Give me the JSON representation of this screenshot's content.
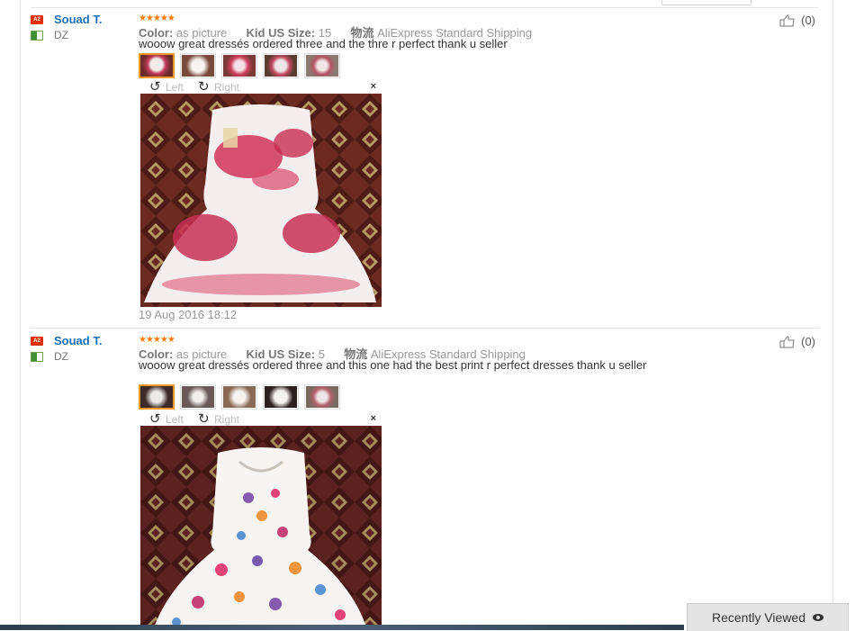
{
  "reviews": [
    {
      "badge": "A2",
      "user": "Souad T.",
      "country": "DZ",
      "stars": "★★★★★",
      "color_label": "Color:",
      "color_value": "as picture",
      "size_label": "Kid US Size:",
      "size_value": "15",
      "shipping_label": "物流",
      "shipping_value": "AliExpress Standard Shipping",
      "text": "wooow great dressés ordered three and the thre r perfect thank u seller",
      "rotate_left": "Left",
      "rotate_right": "Right",
      "close": "×",
      "date": "19 Aug 2016 18:12",
      "helpful_count": "(0)"
    },
    {
      "badge": "A2",
      "user": "Souad T.",
      "country": "DZ",
      "stars": "★★★★★",
      "color_label": "Color:",
      "color_value": "as picture",
      "size_label": "Kid US Size:",
      "size_value": "5",
      "shipping_label": "物流",
      "shipping_value": "AliExpress Standard Shipping",
      "text": "wooow great dressés ordered three and this one had the best print r perfect dresses thank u seller",
      "rotate_left": "Left",
      "rotate_right": "Right",
      "close": "×",
      "helpful_count": "(0)"
    }
  ],
  "recently_viewed": "Recently Viewed",
  "colors": {
    "accent": "#e62e04",
    "username": "#1d6fb8",
    "stars": "#ff7a00",
    "selected_thumb": "#f49b25"
  }
}
